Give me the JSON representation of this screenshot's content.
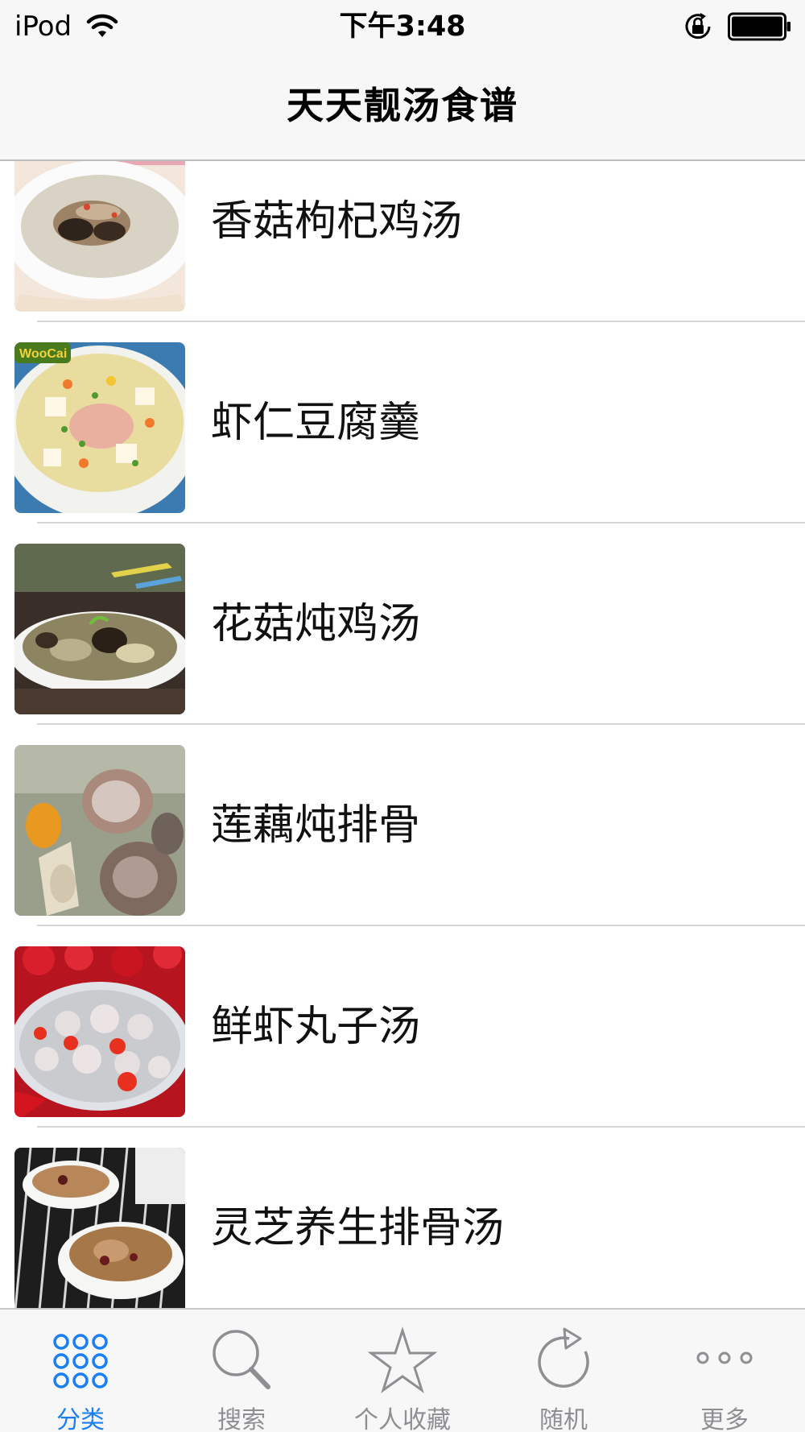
{
  "status_bar": {
    "device": "iPod",
    "time": "下午3:48",
    "icons": [
      "wifi-icon",
      "rotation-lock-icon",
      "battery-icon"
    ]
  },
  "nav": {
    "title": "天天靓汤食谱"
  },
  "list": {
    "items": [
      {
        "label": "香菇枸杞鸡汤",
        "image": "mushroom-goji-chicken-soup-photo"
      },
      {
        "label": "虾仁豆腐羹",
        "image": "shrimp-tofu-soup-photo"
      },
      {
        "label": "花菇炖鸡汤",
        "image": "flower-mushroom-chicken-soup-photo"
      },
      {
        "label": "莲藕炖排骨",
        "image": "lotus-root-pork-rib-soup-photo"
      },
      {
        "label": "鲜虾丸子汤",
        "image": "shrimp-ball-soup-photo"
      },
      {
        "label": "灵芝养生排骨汤",
        "image": "lingzhi-pork-rib-soup-photo"
      }
    ]
  },
  "tab_bar": {
    "tabs": [
      {
        "label": "分类",
        "icon": "grid-dots-icon",
        "active": true
      },
      {
        "label": "搜索",
        "icon": "search-icon",
        "active": false
      },
      {
        "label": "个人收藏",
        "icon": "star-icon",
        "active": false
      },
      {
        "label": "随机",
        "icon": "refresh-icon",
        "active": false
      },
      {
        "label": "更多",
        "icon": "more-icon",
        "active": false
      }
    ]
  },
  "colors": {
    "accent": "#1a7ef5",
    "tab_inactive": "#8e8e93",
    "bar_background": "#f7f7f7",
    "separator": "#d6d6d6"
  }
}
